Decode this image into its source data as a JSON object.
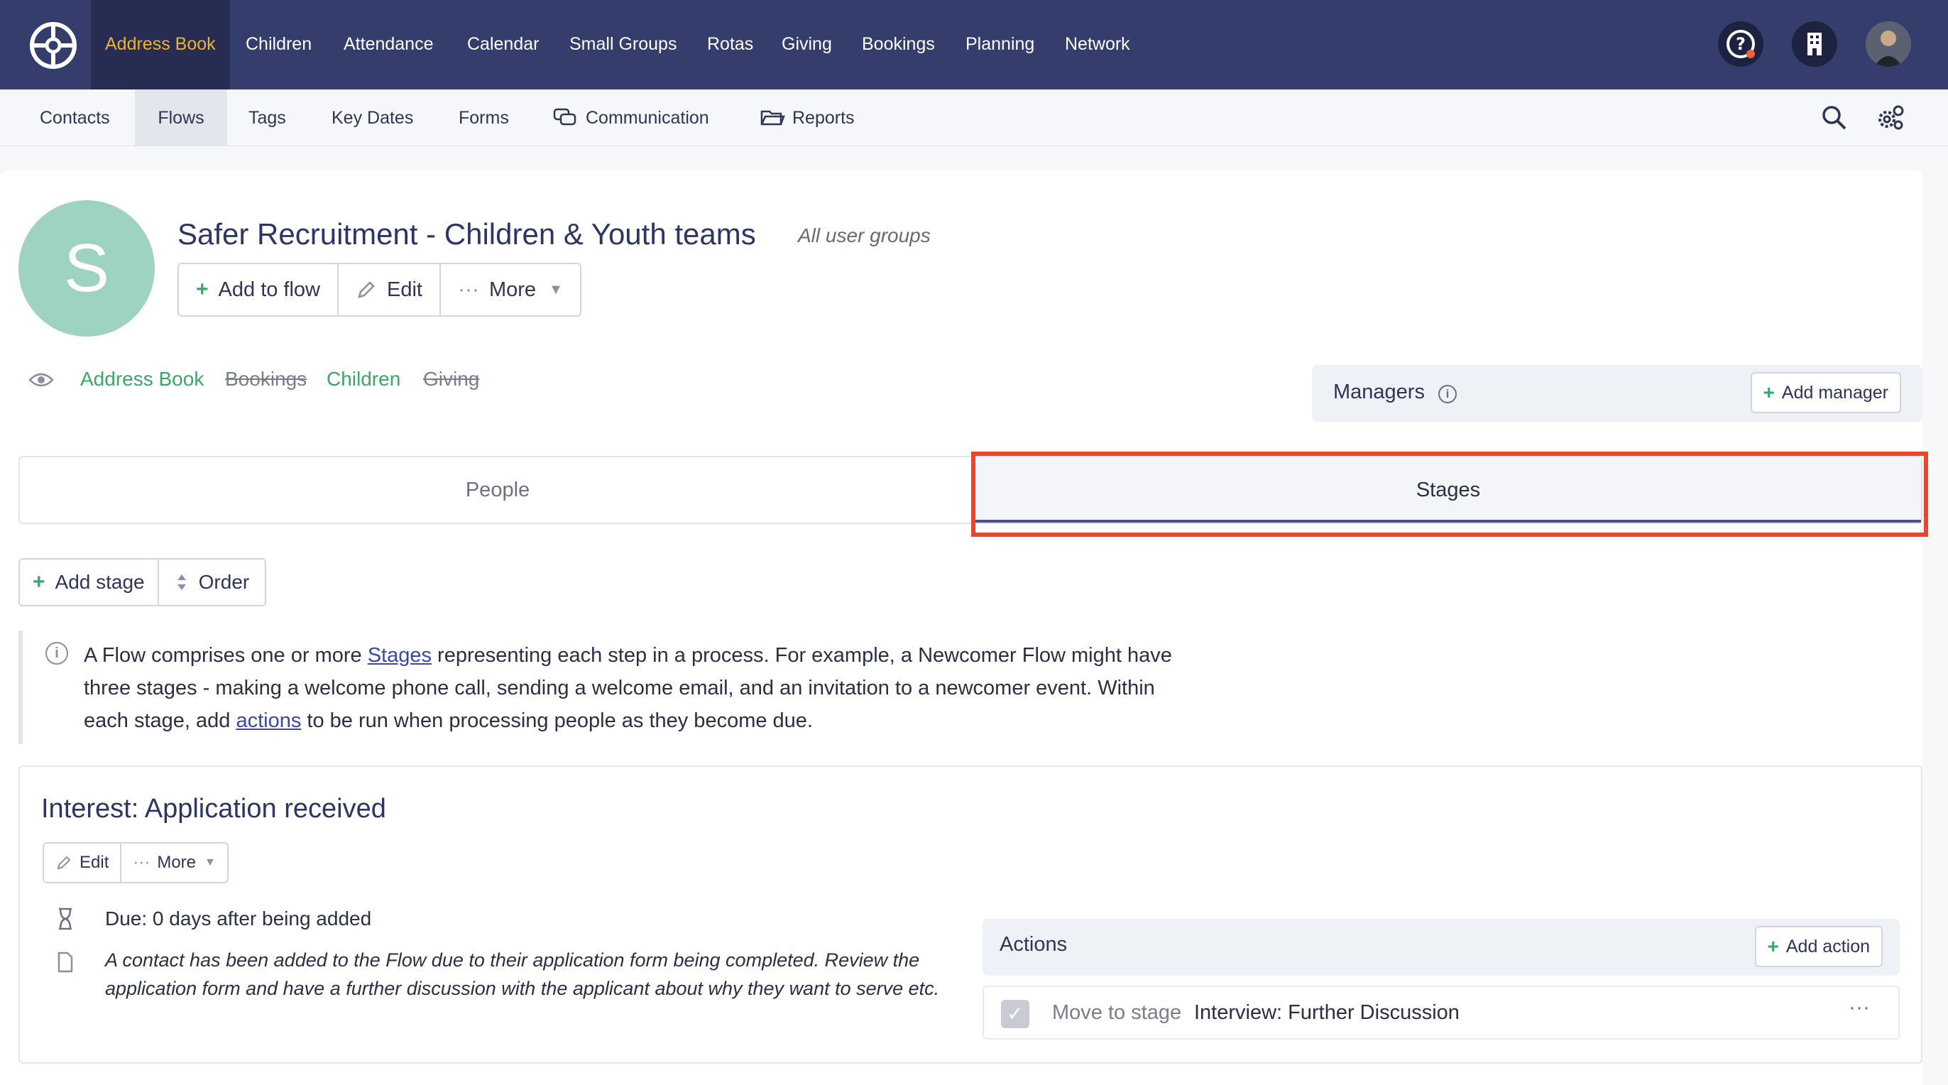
{
  "topnav": {
    "items": [
      {
        "label": "Address Book"
      },
      {
        "label": "Children"
      },
      {
        "label": "Attendance"
      },
      {
        "label": "Calendar"
      },
      {
        "label": "Small Groups"
      },
      {
        "label": "Rotas"
      },
      {
        "label": "Giving"
      },
      {
        "label": "Bookings"
      },
      {
        "label": "Planning"
      },
      {
        "label": "Network"
      }
    ],
    "active": "Address Book",
    "icons": [
      "logo-icon",
      "help-icon",
      "building-icon",
      "user-avatar"
    ]
  },
  "subnav": {
    "items": [
      {
        "label": "Contacts"
      },
      {
        "label": "Flows"
      },
      {
        "label": "Tags"
      },
      {
        "label": "Key Dates"
      },
      {
        "label": "Forms"
      },
      {
        "label": "Communication"
      },
      {
        "label": "Reports"
      }
    ],
    "active": "Flows"
  },
  "flow": {
    "avatar_letter": "S",
    "title": "Safer Recruitment - Children & Youth teams",
    "user_groups": "All user groups",
    "buttons": {
      "add": "Add to flow",
      "edit": "Edit",
      "more": "More"
    },
    "modules": [
      {
        "label": "Address Book",
        "enabled": true
      },
      {
        "label": "Bookings",
        "enabled": false
      },
      {
        "label": "Children",
        "enabled": true
      },
      {
        "label": "Giving",
        "enabled": false
      }
    ],
    "managers_label": "Managers",
    "add_manager": "Add manager"
  },
  "tabs": {
    "people": "People",
    "stages": "Stages",
    "active": "Stages"
  },
  "stages_toolbar": {
    "add_stage": "Add stage",
    "order": "Order"
  },
  "info_note": {
    "part1": "A Flow comprises one or more ",
    "link1": "Stages",
    "part2": " representing each step in a process. For example, a Newcomer Flow might have three stages - making a welcome phone call, sending a welcome email, and an invitation to a newcomer event. Within each stage, add ",
    "link2": "actions",
    "part3": " to be run when processing people as they become due."
  },
  "stage": {
    "title": "Interest: Application received",
    "edit": "Edit",
    "more": "More",
    "due": "Due: 0 days after being added",
    "description": "A contact has been added to the Flow due to their application form being completed. Review the application form and have a further discussion with the applicant about why they want to serve etc.",
    "actions_label": "Actions",
    "add_action": "Add action",
    "actions": [
      {
        "kind": "Move to stage",
        "target": "Interview: Further Discussion"
      }
    ]
  },
  "colors": {
    "nav_bg": "#343d6b",
    "accent": "#f0b429",
    "green": "#3aa66a",
    "highlight": "#e8462d"
  }
}
